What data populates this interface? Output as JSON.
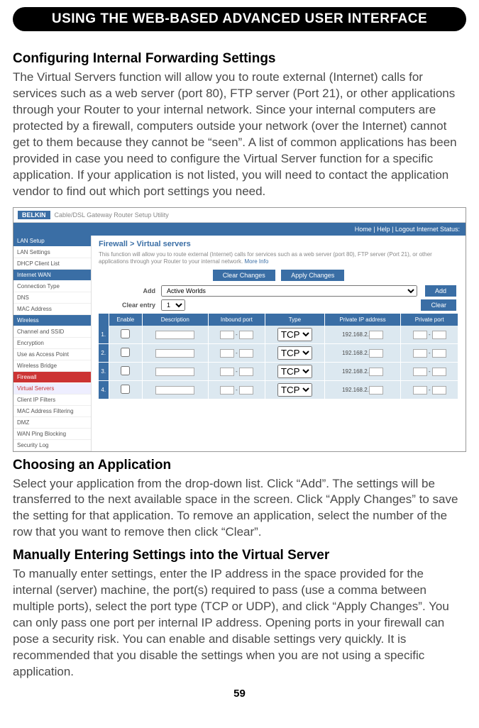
{
  "banner": "USING THE WEB-BASED ADVANCED USER INTERFACE",
  "s1_title": "Configuring Internal Forwarding Settings",
  "s1_body": "The Virtual Servers function will allow you to route external (Internet) calls for services such as a web server (port 80), FTP server (Port 21), or other applications through your Router to your internal network. Since your internal computers are protected by a firewall, computers outside your network (over the Internet) cannot get to them because they cannot be “seen”. A list of common applications has been provided in case you need to configure the Virtual Server function for a specific application. If your application is not listed, you will need to contact the application vendor to find out which port settings you need.",
  "ss": {
    "brand": "BELKIN",
    "win_title": "Cable/DSL Gateway Router Setup Utility",
    "topbar": "Home | Help | Logout    Internet Status:",
    "side_groups": [
      {
        "header": "LAN Setup",
        "class": "hdr",
        "items": [
          "LAN Settings",
          "DHCP Client List"
        ]
      },
      {
        "header": "Internet WAN",
        "class": "hdr",
        "items": [
          "Connection Type",
          "DNS",
          "MAC Address"
        ]
      },
      {
        "header": "Wireless",
        "class": "hdr",
        "items": [
          "Channel and SSID",
          "Encryption",
          "Use as Access Point",
          "Wireless Bridge"
        ]
      },
      {
        "header": "Firewall",
        "class": "hdr red",
        "items": [
          {
            "t": "Virtual Servers",
            "sel": true
          },
          "Client IP Filters",
          "MAC Address Filtering",
          "DMZ",
          "WAN Ping Blocking",
          "Security Log"
        ]
      }
    ],
    "crumb": "Firewall > Virtual servers",
    "desc": "This function will allow you to route external (Internet) calls for services such as a web server (port 80), FTP server (Port 21), or other applications through your Router to your internal network.",
    "more": "More Info",
    "btn_clear_changes": "Clear Changes",
    "btn_apply": "Apply Changes",
    "lbl_add": "Add",
    "add_value": "Active Worlds",
    "btn_add": "Add",
    "lbl_clear": "Clear entry",
    "clear_value": "1",
    "btn_clear": "Clear",
    "th": [
      "",
      "Enable",
      "Description",
      "Inbound port",
      "Type",
      "Private IP address",
      "Private port"
    ],
    "rows": [
      {
        "n": "1.",
        "type": "TCP",
        "ip": "192.168.2."
      },
      {
        "n": "2.",
        "type": "TCP",
        "ip": "192.168.2."
      },
      {
        "n": "3.",
        "type": "TCP",
        "ip": "192.168.2."
      },
      {
        "n": "4.",
        "type": "TCP",
        "ip": "192.168.2."
      }
    ]
  },
  "s2_title": "Choosing an Application",
  "s2_body": "Select your application from the drop-down list. Click “Add”. The settings will be transferred to the next available space in the screen. Click “Apply Changes” to save the setting for that application. To remove an application, select the number of the row that you want to remove then click “Clear”.",
  "s3_title": "Manually Entering Settings into the Virtual Server",
  "s3_body": "To manually enter settings, enter the IP address in the space provided for the internal (server) machine, the port(s) required to pass (use a comma between multiple ports), select the port type (TCP or UDP), and click “Apply Changes”. You can only pass one port per internal IP address. Opening ports in your firewall can pose a security risk. You can enable and disable settings very quickly. It is recommended that you disable the settings when you are not using a specific application.",
  "page": "59"
}
